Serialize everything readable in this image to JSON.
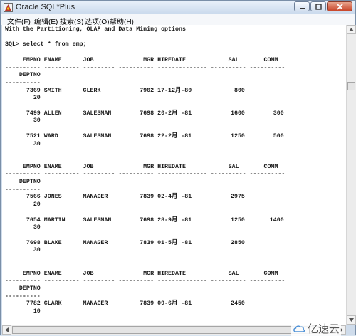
{
  "window": {
    "title": "Oracle SQL*Plus"
  },
  "menu": [
    "文件(F)",
    "编辑(E)",
    "搜索(S)",
    "选项(O)",
    "帮助(H)"
  ],
  "console_lines": [
    "With the Partitioning, OLAP and Data Mining options",
    "",
    "SQL> select * from emp;",
    "",
    "     EMPNO ENAME      JOB              MGR HIREDATE            SAL       COMM",
    "---------- ---------- --------- ---------- -------------- ---------- ----------",
    "    DEPTNO",
    "----------",
    "      7369 SMITH      CLERK           7902 17-12月-80            800",
    "        20",
    "",
    "      7499 ALLEN      SALESMAN        7698 20-2月 -81           1600        300",
    "        30",
    "",
    "      7521 WARD       SALESMAN        7698 22-2月 -81           1250        500",
    "        30",
    "",
    "",
    "     EMPNO ENAME      JOB              MGR HIREDATE            SAL       COMM",
    "---------- ---------- --------- ---------- -------------- ---------- ----------",
    "    DEPTNO",
    "----------",
    "      7566 JONES      MANAGER         7839 02-4月 -81           2975",
    "        20",
    "",
    "      7654 MARTIN     SALESMAN        7698 28-9月 -81           1250       1400",
    "        30",
    "",
    "      7698 BLAKE      MANAGER         7839 01-5月 -81           2850",
    "        30",
    "",
    "",
    "     EMPNO ENAME      JOB              MGR HIREDATE            SAL       COMM",
    "---------- ---------- --------- ---------- -------------- ---------- ----------",
    "    DEPTNO",
    "----------",
    "      7782 CLARK      MANAGER         7839 09-6月 -81           2450",
    "        10"
  ],
  "watermark": {
    "text": "亿速云"
  },
  "icons": {
    "app": "sqlplus-app-icon",
    "minimize": "minimize-icon",
    "maximize": "maximize-icon",
    "close": "close-icon",
    "scroll_up": "arrow-up-icon",
    "scroll_down": "arrow-down-icon",
    "scroll_left": "arrow-left-icon",
    "scroll_right": "arrow-right-icon",
    "watermark_logo": "cloud-logo-icon"
  },
  "colors": {
    "console_bg": "#ffffff",
    "console_text": "#1a1a1a",
    "close_button": "#c8452a"
  }
}
